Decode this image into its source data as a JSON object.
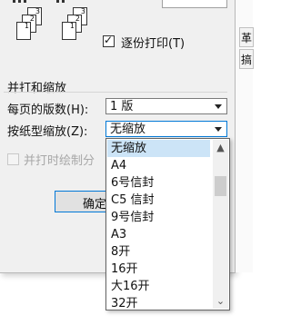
{
  "collate": {
    "label": "逐份打印(T)",
    "checked": true,
    "check_glyph": "✓",
    "page_numbers": [
      "3",
      "2",
      "1",
      "3",
      "2",
      "1"
    ]
  },
  "section": {
    "title": "并打和缩放"
  },
  "pages_per_sheet": {
    "label": "每页的版数(H):",
    "value": "1 版"
  },
  "scale_to_paper": {
    "label": "按纸型缩放(Z):",
    "value": "无缩放"
  },
  "print_lines": {
    "label": "并打时绘制分"
  },
  "ok_button": {
    "label": "确定"
  },
  "right_pane": {
    "tab_labels": [
      "革",
      "搞"
    ]
  },
  "dropdown": {
    "items": [
      "无缩放",
      "A4",
      "6号信封",
      "C5 信封",
      "9号信封",
      "A3",
      "8开",
      "16开",
      "大16开",
      "32开"
    ],
    "selected_index": 0,
    "scroll_up_glyph": "▲",
    "scroll_down_glyph": "⌄"
  },
  "colors": {
    "selection": "#cce4f7",
    "focus": "#0078d7",
    "dialog_bg": "#f0f0f0"
  }
}
